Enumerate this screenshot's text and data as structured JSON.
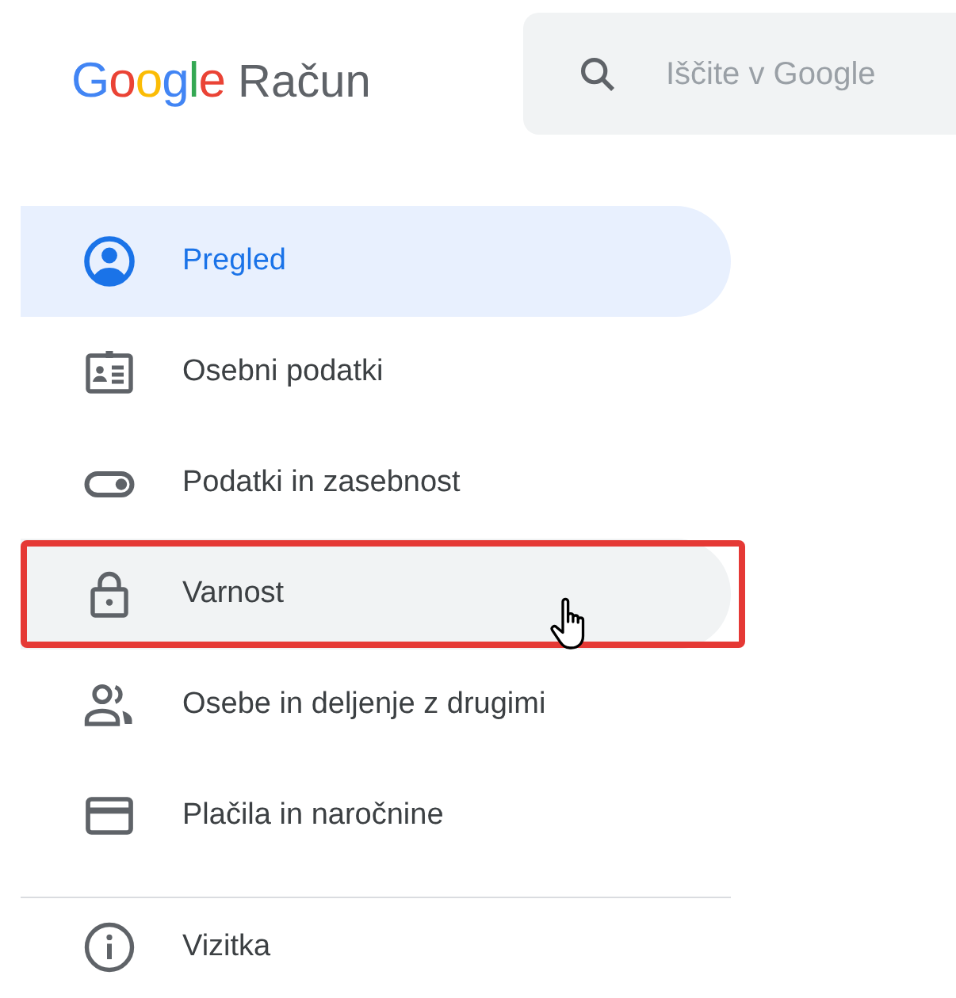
{
  "header": {
    "logo_brand": "Google",
    "logo_product": "Račun",
    "search": {
      "placeholder": "Iščite v Google"
    }
  },
  "nav_items": [
    {
      "label": "Pregled",
      "kind": "account",
      "selected": true,
      "hovered": false,
      "highlighted": false
    },
    {
      "label": "Osebni podatki",
      "kind": "id-card",
      "selected": false,
      "hovered": false,
      "highlighted": false
    },
    {
      "label": "Podatki in zasebnost",
      "kind": "toggle",
      "selected": false,
      "hovered": false,
      "highlighted": false
    },
    {
      "label": "Varnost",
      "kind": "lock",
      "selected": false,
      "hovered": true,
      "highlighted": true
    },
    {
      "label": "Osebe in deljenje z drugimi",
      "kind": "people",
      "selected": false,
      "hovered": false,
      "highlighted": false
    },
    {
      "label": "Plačila in naročnine",
      "kind": "card",
      "selected": false,
      "hovered": false,
      "highlighted": false
    }
  ],
  "secondary_items": [
    {
      "label": "Vizitka",
      "kind": "info",
      "selected": false,
      "hovered": false,
      "highlighted": false
    }
  ]
}
